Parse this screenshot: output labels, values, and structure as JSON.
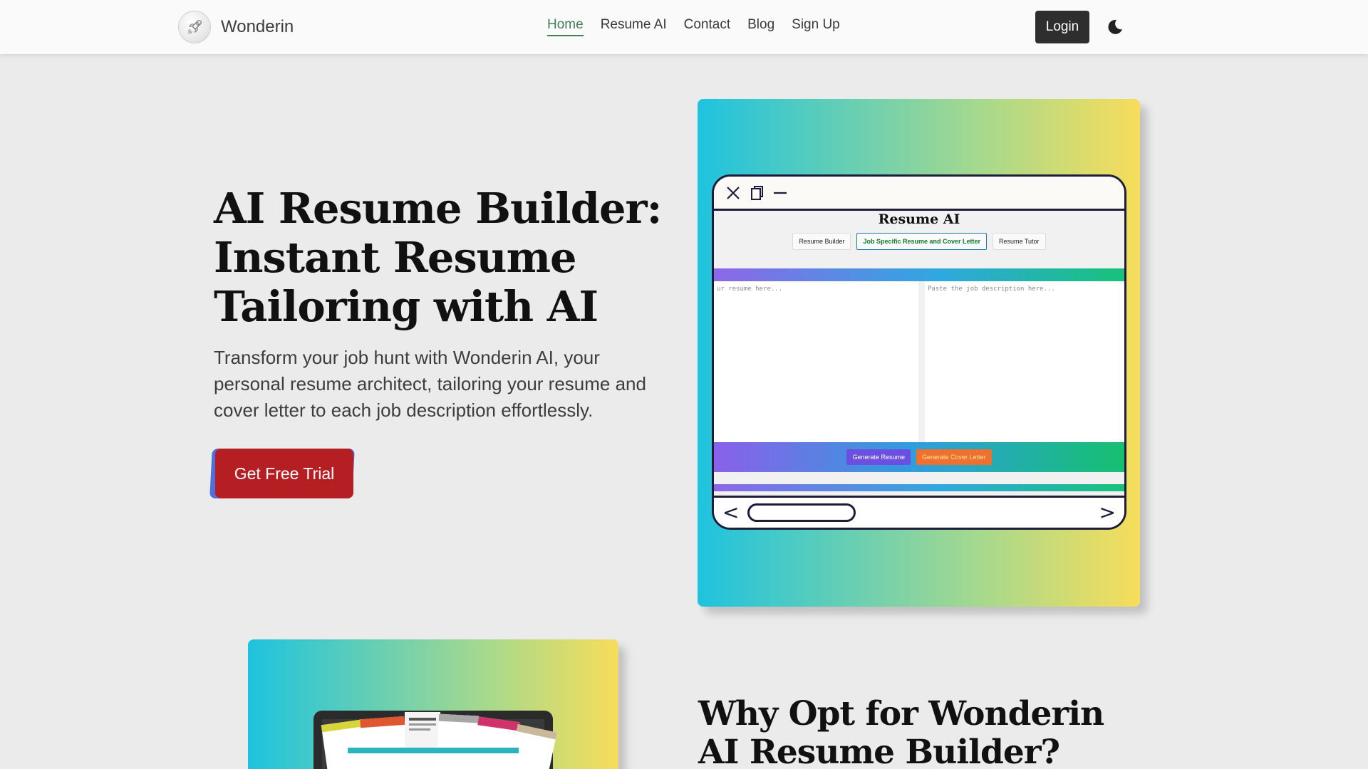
{
  "nav": {
    "brand": "Wonderin",
    "links": [
      "Home",
      "Resume AI",
      "Contact",
      "Blog",
      "Sign Up"
    ],
    "active_link": "Home",
    "login": "Login",
    "theme_icon": "moon-icon"
  },
  "hero": {
    "title": "AI Resume Builder: Instant Resume Tailoring with AI",
    "subtitle": "Transform your job hunt with Wonderin AI, your personal resume architect, tailoring your resume and cover letter to each job description effortlessly.",
    "cta": "Get Free Trial"
  },
  "mockup": {
    "title": "Resume AI",
    "tabs": [
      "Resume Builder",
      "Job Specific Resume and Cover Letter",
      "Resume Tutor"
    ],
    "active_tab": "Job Specific Resume and Cover Letter",
    "resume_placeholder": "ur resume here...",
    "job_placeholder": "Paste the job description here...",
    "generate_resume": "Generate Resume",
    "generate_cover_letter": "Generate Cover Letter",
    "back_symbol": "<",
    "forward_symbol": ">"
  },
  "section2": {
    "title": "Why Opt for Wonderin AI Resume Builder?"
  },
  "colors": {
    "cta": "#b51e22",
    "cta_shadow": "#4f6fdc",
    "login_bg": "#2e2e2e",
    "active_link": "#3f7f57",
    "gradient_start": "#1ec3df",
    "gradient_end": "#f7dd5a"
  }
}
